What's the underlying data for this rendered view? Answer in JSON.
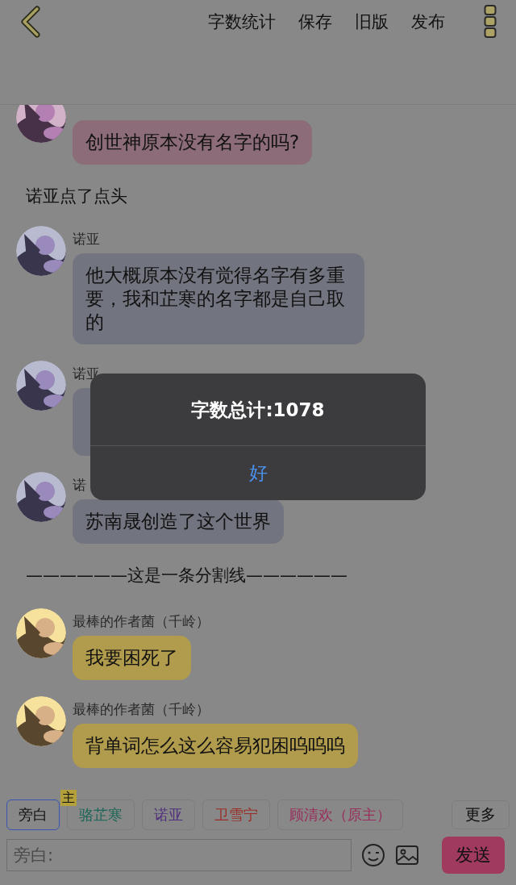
{
  "header": {
    "actions": [
      "字数统计",
      "保存",
      "旧版",
      "发布"
    ]
  },
  "messages": [
    {
      "kind": "chat",
      "text": "创世神原本没有名字的吗?",
      "color": "#8c6c78"
    },
    {
      "kind": "narration",
      "text": "诺亚点了点头"
    },
    {
      "kind": "chat",
      "name": "诺亚",
      "text": "他大概原本没有觉得名字有多重要，我和芷寒的名字都是自己取的",
      "color": "#72757f"
    },
    {
      "kind": "chat",
      "name": "诺亚",
      "color": "#72757f"
    },
    {
      "kind": "chat",
      "name": "诺",
      "text": "苏南晟创造了这个世界",
      "color": "#72757f"
    },
    {
      "kind": "divider",
      "text": "——————这是一条分割线——————"
    },
    {
      "kind": "chat",
      "name": "最棒的作者菌（千岭）",
      "text": "我要困死了",
      "color": "#b09c4c"
    },
    {
      "kind": "chat",
      "name": "最棒的作者菌（千岭）",
      "text": "背单词怎么这么容易犯困呜呜呜",
      "color": "#b09c4c"
    }
  ],
  "role_tabs": [
    {
      "label": "旁白",
      "selected": true,
      "color": "#111111"
    },
    {
      "label": "骆芷寒",
      "selected": false,
      "color": "#1c6658",
      "badge": "主"
    },
    {
      "label": "诺亚",
      "selected": false,
      "color": "#4f2f7c"
    },
    {
      "label": "卫雪宁",
      "selected": false,
      "color": "#992e26"
    },
    {
      "label": "顾清欢（原主）",
      "selected": false,
      "color": "#992e5c"
    }
  ],
  "more_button": "更多",
  "input": {
    "placeholder": "旁白:"
  },
  "send_button": "发送",
  "dialog": {
    "message": "字数总计:1078",
    "button": "好"
  }
}
